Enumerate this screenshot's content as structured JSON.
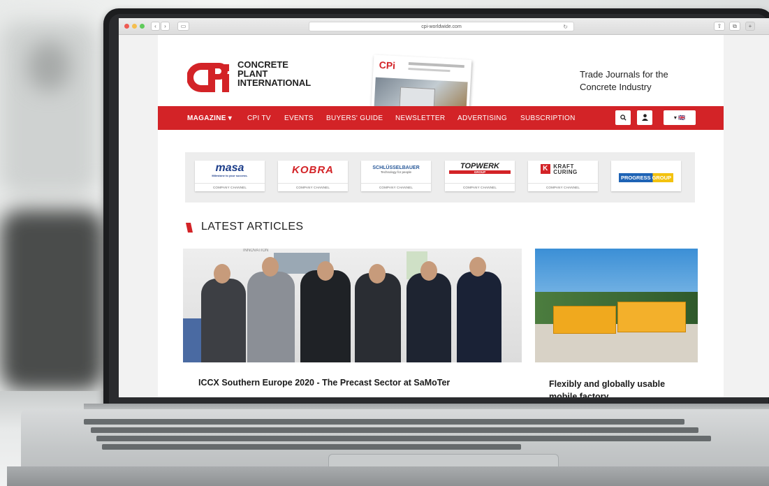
{
  "browser": {
    "url": "cpi-worldwide.com",
    "back": "‹",
    "forward": "›",
    "sidebar": "▭",
    "reload": "↻",
    "share": "⇧",
    "tabs": "⧉",
    "add": "+"
  },
  "header": {
    "logo_letters": "CPi",
    "logo_line1": "CONCRETE",
    "logo_line2": "PLANT",
    "logo_line3": "INTERNATIONAL",
    "tagline_line1": "Trade Journals for the",
    "tagline_line2": "Concrete Industry",
    "magazine_cover_logo": "CPi"
  },
  "menu": {
    "items": [
      "MAGAZINE ▾",
      "CPI TV",
      "EVENTS",
      "BUYERS' GUIDE",
      "NEWSLETTER",
      "ADVERTISING",
      "SUBSCRIPTION"
    ],
    "search_icon": "search-icon",
    "user_icon": "user-icon",
    "language": "▾ 🇬🇧"
  },
  "channels": [
    {
      "name": "masa",
      "tagline": "Milestone to your success.",
      "sub": "COMPANY CHANNEL",
      "color": "#1d3e8a"
    },
    {
      "name": "KOBRA",
      "tagline": "",
      "sub": "COMPANY CHANNEL",
      "color": "#d32327"
    },
    {
      "name": "SCHLÜSSELBAUER",
      "tagline": "Technology for people",
      "sub": "COMPANY CHANNEL",
      "color": "#2a5a9a"
    },
    {
      "name": "TOPWERK",
      "tagline": "GROUP",
      "sub": "COMPANY CHANNEL",
      "color": "#222222"
    },
    {
      "name": "KRAFT CURING",
      "tagline": "",
      "sub": "COMPANY CHANNEL",
      "color": "#333333"
    },
    {
      "name": "PROGRESS GROUP",
      "tagline": "",
      "sub": "",
      "color": "#1e63b5"
    }
  ],
  "section": {
    "title": "LATEST ARTICLES"
  },
  "articles": [
    {
      "title": "ICCX Southern Europe 2020 -  The Precast Sector at SaMoTer",
      "image_label": "INNOVATION"
    },
    {
      "title": "Flexibly and globally usable mobile factory",
      "image_label": ""
    }
  ],
  "colors": {
    "brand_red": "#d32327",
    "text": "#222222"
  }
}
